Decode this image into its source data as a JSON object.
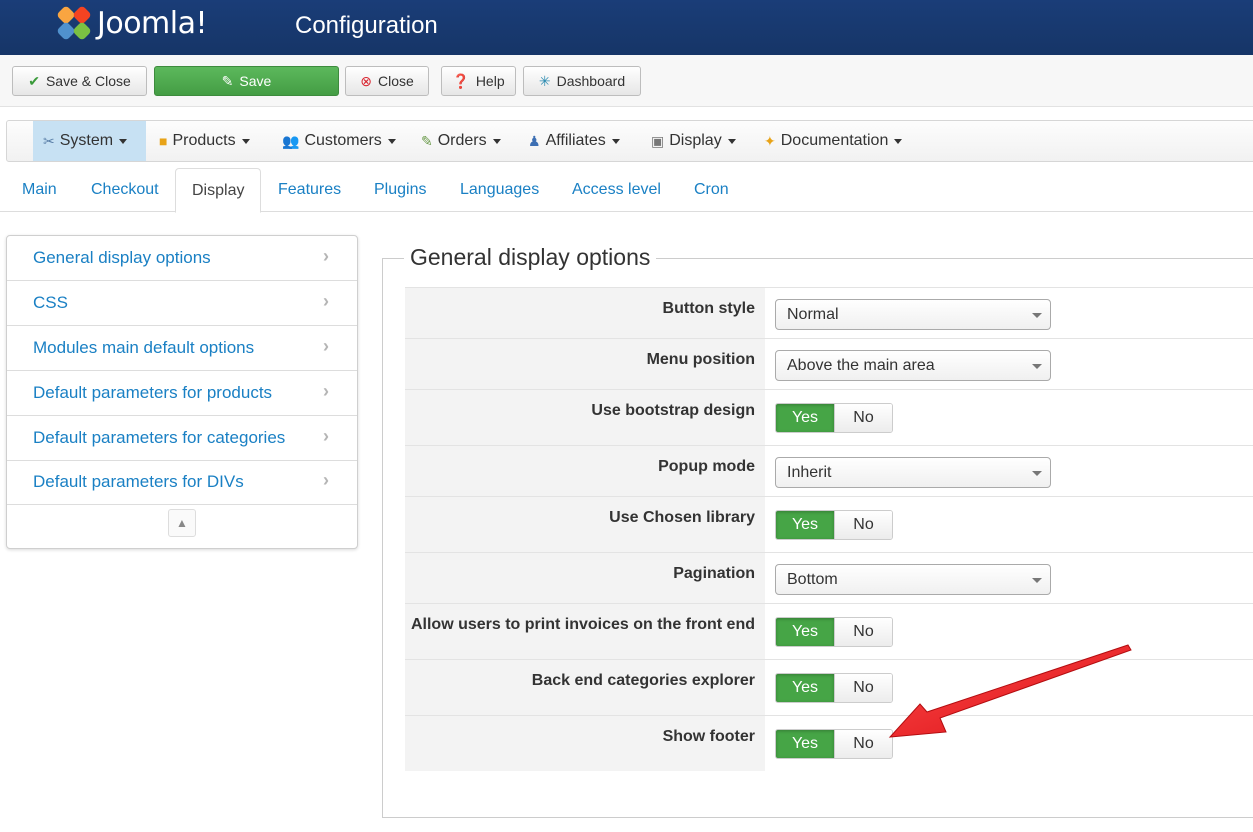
{
  "header": {
    "brand": "Joomla!",
    "title": "Configuration"
  },
  "toolbar": {
    "save_close": "Save & Close",
    "save": "Save",
    "close": "Close",
    "help": "Help",
    "dashboard": "Dashboard"
  },
  "menu": {
    "items": [
      {
        "label": "System",
        "icon": "tools-icon"
      },
      {
        "label": "Products",
        "icon": "box-icon"
      },
      {
        "label": "Customers",
        "icon": "users-icon"
      },
      {
        "label": "Orders",
        "icon": "orders-icon"
      },
      {
        "label": "Affiliates",
        "icon": "affiliates-icon"
      },
      {
        "label": "Display",
        "icon": "display-icon"
      },
      {
        "label": "Documentation",
        "icon": "documentation-icon"
      }
    ]
  },
  "tabs": [
    "Main",
    "Checkout",
    "Display",
    "Features",
    "Plugins",
    "Languages",
    "Access level",
    "Cron"
  ],
  "active_tab": "Display",
  "sidebar": {
    "items": [
      "General display options",
      "CSS",
      "Modules main default options",
      "Default parameters for products",
      "Default parameters for categories",
      "Default parameters for DIVs"
    ]
  },
  "section": {
    "title": "General display options",
    "toggle_yes": "Yes",
    "toggle_no": "No",
    "rows": [
      {
        "label": "Button style",
        "type": "select",
        "value": "Normal"
      },
      {
        "label": "Menu position",
        "type": "select",
        "value": "Above the main area"
      },
      {
        "label": "Use bootstrap design",
        "type": "toggle",
        "value": "Yes"
      },
      {
        "label": "Popup mode",
        "type": "select",
        "value": "Inherit"
      },
      {
        "label": "Use Chosen library",
        "type": "toggle",
        "value": "Yes"
      },
      {
        "label": "Pagination",
        "type": "select",
        "value": "Bottom"
      },
      {
        "label": "Allow users to print invoices on the front end",
        "type": "toggle",
        "value": "Yes"
      },
      {
        "label": "Back end categories explorer",
        "type": "toggle",
        "value": "Yes"
      },
      {
        "label": "Show footer",
        "type": "toggle",
        "value": "Yes"
      }
    ]
  },
  "colors": {
    "header": "#163567",
    "link": "#1a80c4",
    "toggle_on": "#46a546",
    "annotation_arrow": "#e8161b"
  }
}
